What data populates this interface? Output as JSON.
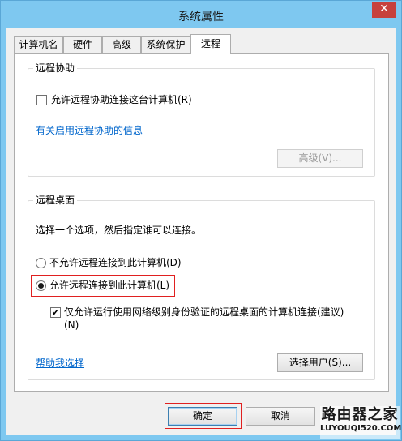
{
  "window": {
    "title": "系统属性",
    "close_glyph": "✕"
  },
  "tabs": [
    {
      "label": "计算机名",
      "active": false
    },
    {
      "label": "硬件",
      "active": false
    },
    {
      "label": "高级",
      "active": false
    },
    {
      "label": "系统保护",
      "active": false
    },
    {
      "label": "远程",
      "active": true
    }
  ],
  "remote_assistance": {
    "group_title": "远程协助",
    "allow_checkbox_label": "允许远程协助连接这台计算机(R)",
    "allow_checked": false,
    "info_link": "有关启用远程协助的信息",
    "advanced_button": "高级(V)..."
  },
  "remote_desktop": {
    "group_title": "远程桌面",
    "instruction": "选择一个选项，然后指定谁可以连接。",
    "options": [
      {
        "label": "不允许远程连接到此计算机(D)",
        "selected": false
      },
      {
        "label": "允许远程连接到此计算机(L)",
        "selected": true
      }
    ],
    "nla_checkbox_label_line1": "仅允许运行使用网络级别身份验证的远程桌面的计算机连接(建议)",
    "nla_checkbox_label_line2": "(N)",
    "nla_checked": true,
    "help_link": "帮助我选择",
    "select_users_button": "选择用户(S)..."
  },
  "footer": {
    "ok_button": "确定",
    "cancel_button": "取消"
  },
  "watermark": {
    "brand_cn": "路由器之家",
    "brand_url": "LUYOUQI520.COM"
  },
  "colors": {
    "title_bar": "#7ec8f0",
    "close_button": "#c7413c",
    "link": "#0066cc",
    "highlight_box": "#e02020"
  }
}
